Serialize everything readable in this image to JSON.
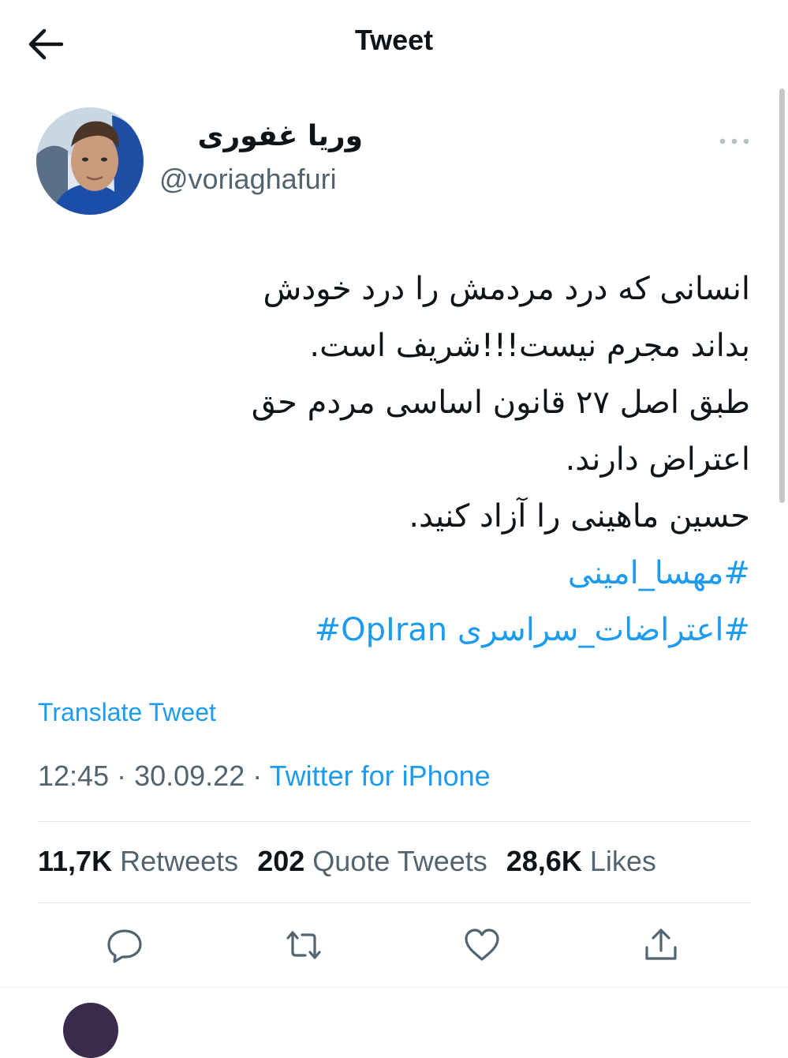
{
  "header": {
    "title": "Tweet",
    "back_icon": "arrow-left-icon"
  },
  "author": {
    "display_name": "وریا غفوری",
    "handle": "@voriaghafuri",
    "more_icon": "more-dots-icon"
  },
  "tweet": {
    "lines": [
      "انسانی که درد مردمش را درد خودش",
      "بداند مجرم نیست!!!شریف است.",
      "طبق اصل ۲۷ قانون اساسی مردم حق",
      "اعتراض دارند.",
      "حسین ماهینی را آزاد کنید."
    ],
    "hashtag_1": "#مهسا_امینی",
    "hashtag_2_fa": "#اعتراضات_سراسری",
    "hashtag_2_en": "#OpIran"
  },
  "translate_label": "Translate Tweet",
  "meta": {
    "time": "12:45",
    "separator": " · ",
    "date": "30.09.22",
    "source": "Twitter for iPhone"
  },
  "stats": {
    "retweets_count": "11,7K",
    "retweets_label": "Retweets",
    "quotes_count": "202",
    "quotes_label": "Quote Tweets",
    "likes_count": "28,6K",
    "likes_label": "Likes"
  },
  "colors": {
    "accent": "#1d9bf0",
    "text": "#0f1419",
    "secondary": "#536471"
  }
}
